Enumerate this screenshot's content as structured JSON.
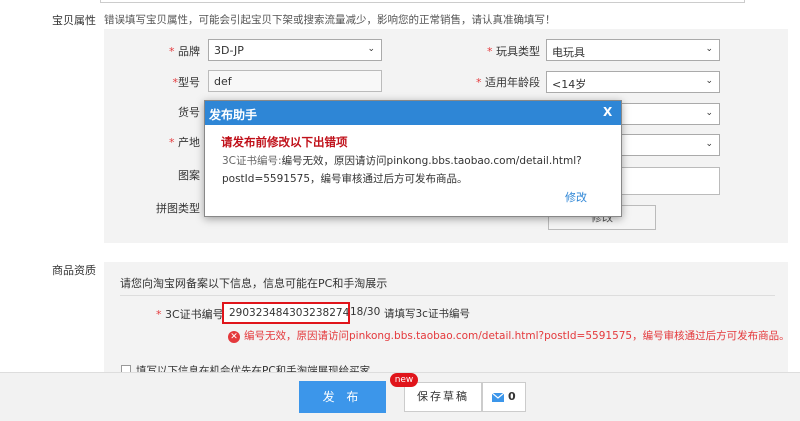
{
  "attributes": {
    "section_label": "宝贝属性",
    "warning": "错误填写宝贝属性，可能会引起宝贝下架或搜索流量减少，影响您的正常销售，请认真准确填写！",
    "brand": {
      "required": "*",
      "label": "品牌",
      "value": "3D-JP"
    },
    "toy_type": {
      "required": "*",
      "label": "玩具类型",
      "value": "电玩具"
    },
    "model": {
      "required": "*",
      "label": "型号",
      "value": "def"
    },
    "age_range": {
      "required": "*",
      "label": "适用年龄段",
      "value": "<14岁"
    },
    "item_no": {
      "label": "货号"
    },
    "origin": {
      "required": "*",
      "label": "产地"
    },
    "pattern": {
      "label": "图案"
    },
    "puzzle_type": {
      "label": "拼图类型"
    },
    "hidden_button": "修改"
  },
  "qualification": {
    "section_label": "商品资质",
    "info": "请您向淘宝网备案以下信息，信息可能在PC和手淘展示",
    "cert_required": "*",
    "cert_label": "3C证书编号",
    "cert_value": "290323484303238274",
    "cert_counter": "18/30",
    "cert_hint": "请填写3c证书编号",
    "cert_error": "编号无效，原因请访问pinkong.bbs.taobao.com/detail.html?postId=5591575，编号审核通过后方可发布商品。",
    "checkbox_text": "填写以下信息在机会优先在PC和手淘端展现给买家"
  },
  "footer": {
    "publish_label": "发 布",
    "draft_label": "保存草稿",
    "new_badge": "new",
    "message_count": "0"
  },
  "dialog": {
    "title": "发布助手",
    "close_label": "X",
    "heading": "请发布前修改以下出错项",
    "item_key": "3C证书编号:",
    "item_msg": "编号无效，原因请访问pinkong.bbs.taobao.com/detail.html?postId=5591575，编号审核通过后方可发布商品。",
    "edit_link": "修改"
  },
  "colors": {
    "accent": "#2e86d6",
    "error": "#e4393c",
    "publish": "#3c96ea"
  }
}
